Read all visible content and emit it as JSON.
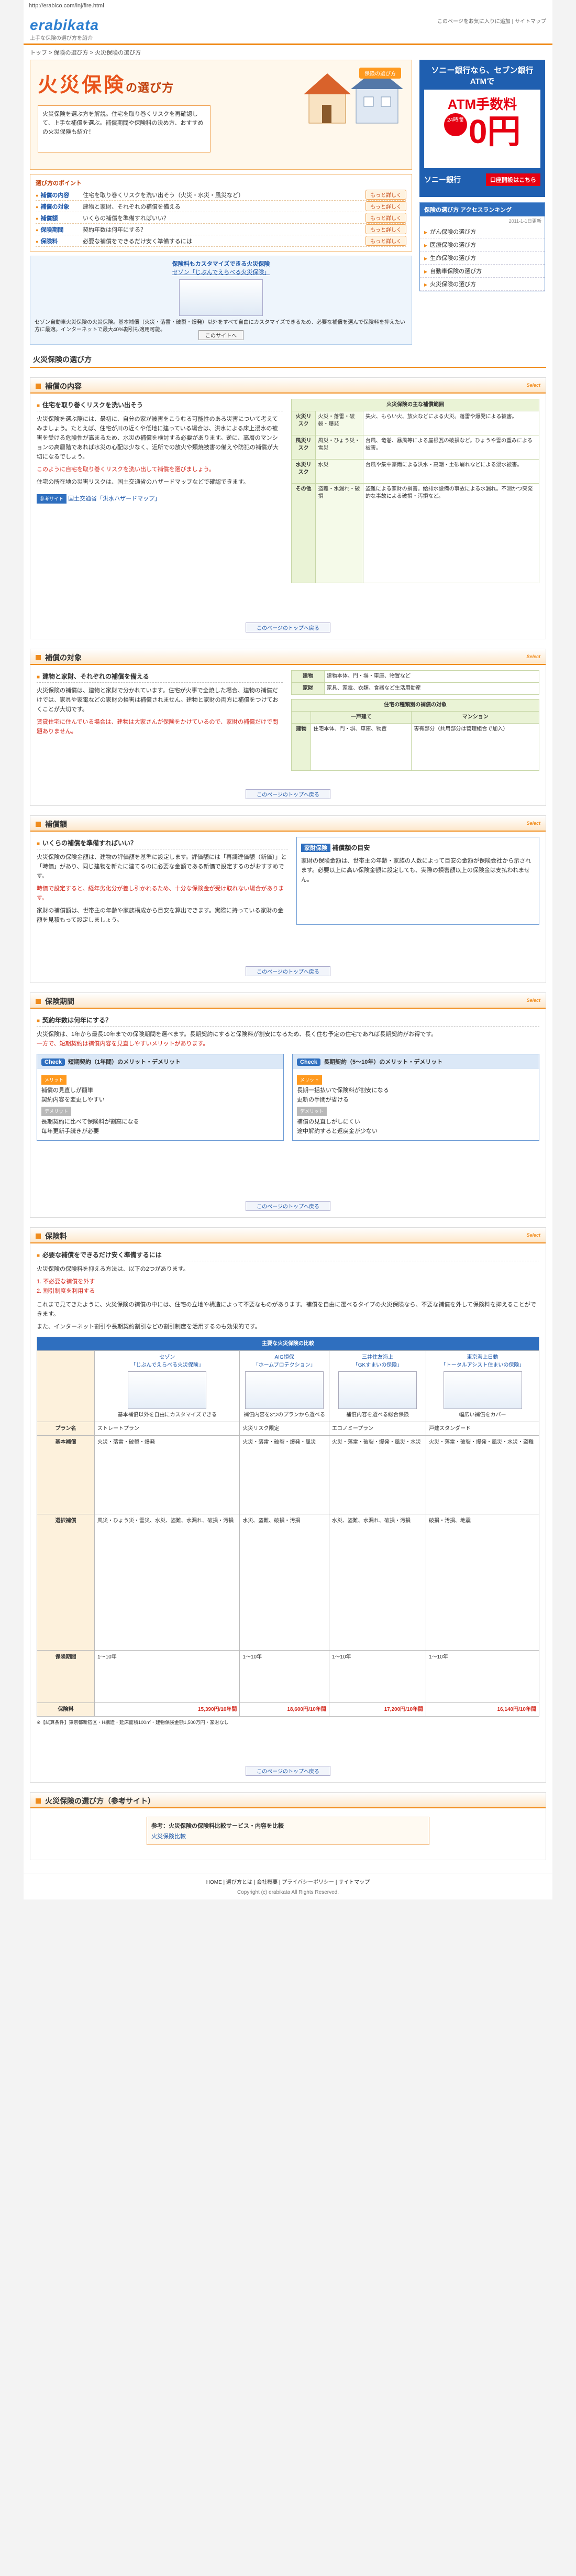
{
  "browser": {
    "url": "http://erabico.com/inj/fire.html"
  },
  "header": {
    "logo": "erabikata",
    "logo_sub": "上手な保険の選び方を紹介",
    "links": "このページをお気に入りに追加 | サイトマップ"
  },
  "breadcrumb": "トップ > 保険の選び方 > 火災保険の選び方",
  "hero": {
    "title": "火災保険",
    "title_suffix": "の選び方",
    "box": "火災保険を選ぶ方を解説。住宅を取り巻くリスクを再確認して、上手な補償を選ぶ。補償期間や保険料の決め方、おすすめの火災保険も紹介！",
    "badge": "保険の選び方"
  },
  "points": {
    "heading": "選び方のポイント",
    "more": "もっと詳しく",
    "rows": [
      {
        "label": "補償の内容",
        "text": "住宅を取り巻くリスクを洗い出そう（火災・水災・風災など）"
      },
      {
        "label": "補償の対象",
        "text": "建物と家財、それぞれの補償を備える"
      },
      {
        "label": "補償額",
        "text": "いくらの補償を準備すればいい？"
      },
      {
        "label": "保険期間",
        "text": "契約年数は何年にする？"
      },
      {
        "label": "保険料",
        "text": "必要な補償をできるだけ安く準備するには"
      }
    ]
  },
  "promo": {
    "heading": "保険料もカスタマイズできる火災保険",
    "link": "セゾン「じぶんでえらべる火災保険」",
    "desc": "セゾン自動車火災保険の火災保険。基本補償（火災・落雷・破裂・爆発）以外をすべて自由にカスタマイズできるため、必要な補償を選んで保険料を抑えたい方に最適。インターネットで最大40%割引も適用可能。",
    "btn": "このサイトへ"
  },
  "ad": {
    "title": "ソニー銀行なら、セブン銀行ATMで",
    "atm": "ATM手数料",
    "hours": "24時間",
    "zero": "0円",
    "bank": "ソニー銀行",
    "open": "口座開設はこちら"
  },
  "ranking": {
    "title": "保険の選び方 アクセスランキング",
    "date": "2011-1-1日更新",
    "items": [
      "がん保険の選び方",
      "医療保険の選び方",
      "生命保険の選び方",
      "自動車保険の選び方",
      "火災保険の選び方"
    ]
  },
  "page_title": "火災保険の選び方",
  "common": {
    "toplink": "このページのトップへ戻る",
    "tag": "Select"
  },
  "s1": {
    "title": "補償の内容",
    "sub": "住宅を取り巻くリスクを洗い出そう",
    "p1": "火災保険を選ぶ際には、最初に、自分の家が被害をこうむる可能性のある災害について考えてみましょう。たとえば、住宅が川の近くや低地に建っている場合は、洪水による床上浸水の被害を受ける危険性が高まるため、水災の補償を検討する必要があります。逆に、高層のマンションの高層階であれば水災の心配は少なく、近所での放火や類焼被害の備えや防犯の補償が大切になるでしょう。",
    "p2": "このように自宅を取り巻くリスクを洗い出して補償を選びましょう。",
    "note": "住宅の所在地の災害リスクは、国土交通省のハザードマップなどで確認できます。",
    "link_label": "参考サイト",
    "link": "国土交通省「洪水ハザードマップ」",
    "table_head": "火災保険の主な補償範囲",
    "rows": [
      {
        "risk": "火災リスク",
        "cause": "火災・落雷・破裂・爆発",
        "desc": "失火、もらい火、放火などによる火災。落雷や爆発による被害。"
      },
      {
        "risk": "風災リスク",
        "cause": "風災・ひょう災・雪災",
        "desc": "台風、竜巻、暴風等による屋根瓦の破損など。ひょうや雪の重みによる被害。"
      },
      {
        "risk": "水災リスク",
        "cause": "水災",
        "desc": "台風や集中豪雨による洪水・高潮・土砂崩れなどによる浸水被害。"
      },
      {
        "risk": "その他",
        "cause": "盗難・水漏れ・破損",
        "desc": "盗難による家財の損害。給排水設備の事故による水漏れ。不測かつ突発的な事故による破損・汚損など。"
      }
    ]
  },
  "s2": {
    "title": "補償の対象",
    "sub": "建物と家財、それぞれの補償を備える",
    "p1": "火災保険の補償は、建物と家財で分かれています。住宅が火事で全焼した場合、建物の補償だけでは、家具や家電などの家財の損害は補償されません。建物と家財の両方に補償をつけておくことが大切です。",
    "p2": "賃貸住宅に住んでいる場合は、建物は大家さんが保険をかけているので、家財の補償だけで問題ありません。",
    "table": [
      {
        "k": "建物",
        "v": "建物本体、門・塀・車庫、物置など"
      },
      {
        "k": "家財",
        "v": "家具、家電、衣類、食器など生活用動産"
      }
    ],
    "table2_head": "住宅の種類別の補償の対象",
    "col1": "一戸建て",
    "col2": "マンション",
    "row_label": "建物",
    "c1": "住宅本体、門・塀、車庫、物置",
    "c2": "専有部分（共用部分は管理組合で加入）"
  },
  "s3": {
    "title": "補償額",
    "sub": "いくらの補償を準備すればいい？",
    "p1": "火災保険の保険金額は、建物の評価額を基準に設定します。評価額には「再調達価額（新価）」と「時価」があり、同じ建物を新たに建てるのに必要な金額である新価で設定するのがおすすめです。",
    "p2": "時価で設定すると、経年劣化分が差し引かれるため、十分な保険金が受け取れない場合があります。",
    "p3": "家財の補償額は、世帯主の年齢や家族構成から目安を算出できます。実際に持っている家財の金額を見積もって設定しましょう。",
    "box_title": "補償額の目安",
    "box_badge": "家財保険",
    "box_text": "家財の保険金額は、世帯主の年齢・家族の人数によって目安の金額が保険会社から示されます。必要以上に高い保険金額に設定しても、実際の損害額以上の保険金は支払われません。"
  },
  "s4": {
    "title": "保険期間",
    "sub": "契約年数は何年にする？",
    "p1": "火災保険は、1年から最長10年までの保険期間を選べます。長期契約にすると保険料が割安になるため、長く住む予定の住宅であれば長期契約がお得です。",
    "p2": "一方で、短期契約は補償内容を見直しやすいメリットがあります。",
    "c1_badge": "Check",
    "c1_title": "短期契約（1年間）のメリット・デメリット",
    "c2_badge": "Check",
    "c2_title": "長期契約（5〜10年）のメリット・デメリット",
    "merit": "メリット",
    "demerit": "デメリット",
    "c1_m": [
      "補償の見直しが簡単",
      "契約内容を変更しやすい"
    ],
    "c1_d": [
      "長期契約に比べて保険料が割高になる",
      "毎年更新手続きが必要"
    ],
    "c2_m": [
      "長期一括払いで保険料が割安になる",
      "更新の手間が省ける"
    ],
    "c2_d": [
      "補償の見直しがしにくい",
      "途中解約すると返戻金が少ない"
    ]
  },
  "s5": {
    "title": "保険料",
    "sub": "必要な補償をできるだけ安く準備するには",
    "p1": "火災保険の保険料を抑える方法は、以下の2つがあります。",
    "list": [
      "1. 不必要な補償を外す",
      "2. 割引制度を利用する"
    ],
    "p2": "これまで見てきたように、火災保険の補償の中には、住宅の立地や構造によって不要なものがあります。補償を自由に選べるタイプの火災保険なら、不要な補償を外して保険料を抑えることができます。",
    "p3": "また、インターネット割引や長期契約割引などの割引制度を活用するのも効果的です。",
    "table_head": "主要な火災保険の比較",
    "companies": [
      {
        "name": "セゾン",
        "product": "「じぶんでえらべる火災保険」",
        "desc": "基本補償以外を自由にカスタマイズできる",
        "plan": "ストレートプラン",
        "price": "15,390円/10年間"
      },
      {
        "name": "AIG損保",
        "product": "「ホームプロテクション」",
        "desc": "補償内容を3つのプランから選べる",
        "plan": "火災リスク限定",
        "price": "18,600円/10年間"
      },
      {
        "name": "三井住友海上",
        "product": "「GKすまいの保険」",
        "desc": "補償内容を選べる総合保険",
        "plan": "エコノミープラン",
        "price": "17,200円/10年間"
      },
      {
        "name": "東京海上日動",
        "product": "「トータルアシスト住まいの保険」",
        "desc": "幅広い補償をカバー",
        "plan": "戸建スタンダード",
        "price": "16,140円/10年間"
      }
    ],
    "row_plan": "プラン名",
    "row_basic": "基本補償",
    "row_option": "選択補償",
    "row_period": "保険期間",
    "row_price": "保険料",
    "basic": [
      "火災・落雷・破裂・爆発",
      "火災・落雷・破裂・爆発・風災",
      "火災・落雷・破裂・爆発・風災・水災",
      "火災・落雷・破裂・爆発・風災・水災・盗難"
    ],
    "option": [
      "風災・ひょう災・雪災、水災、盗難、水漏れ、破損・汚損",
      "水災、盗難、破損・汚損",
      "水災、盗難、水漏れ、破損・汚損",
      "破損・汚損、地震"
    ],
    "period": [
      "1〜10年",
      "1〜10年",
      "1〜10年",
      "1〜10年"
    ],
    "footnote": "※【試算条件】東京都新宿区・H構造・延床面積100㎡・建物保険金額1,500万円・家財なし"
  },
  "s6": {
    "title": "火災保険の選び方（参考サイト）",
    "ref": "参考：火災保険の保険料比較サービス・内容を比較",
    "link": "火災保険比較"
  },
  "footer": {
    "nav": "HOME | 選び方とは | 会社概要 | プライバシーポリシー | サイトマップ",
    "copy": "Copyright (c) erabikata All Rights Reserved."
  }
}
